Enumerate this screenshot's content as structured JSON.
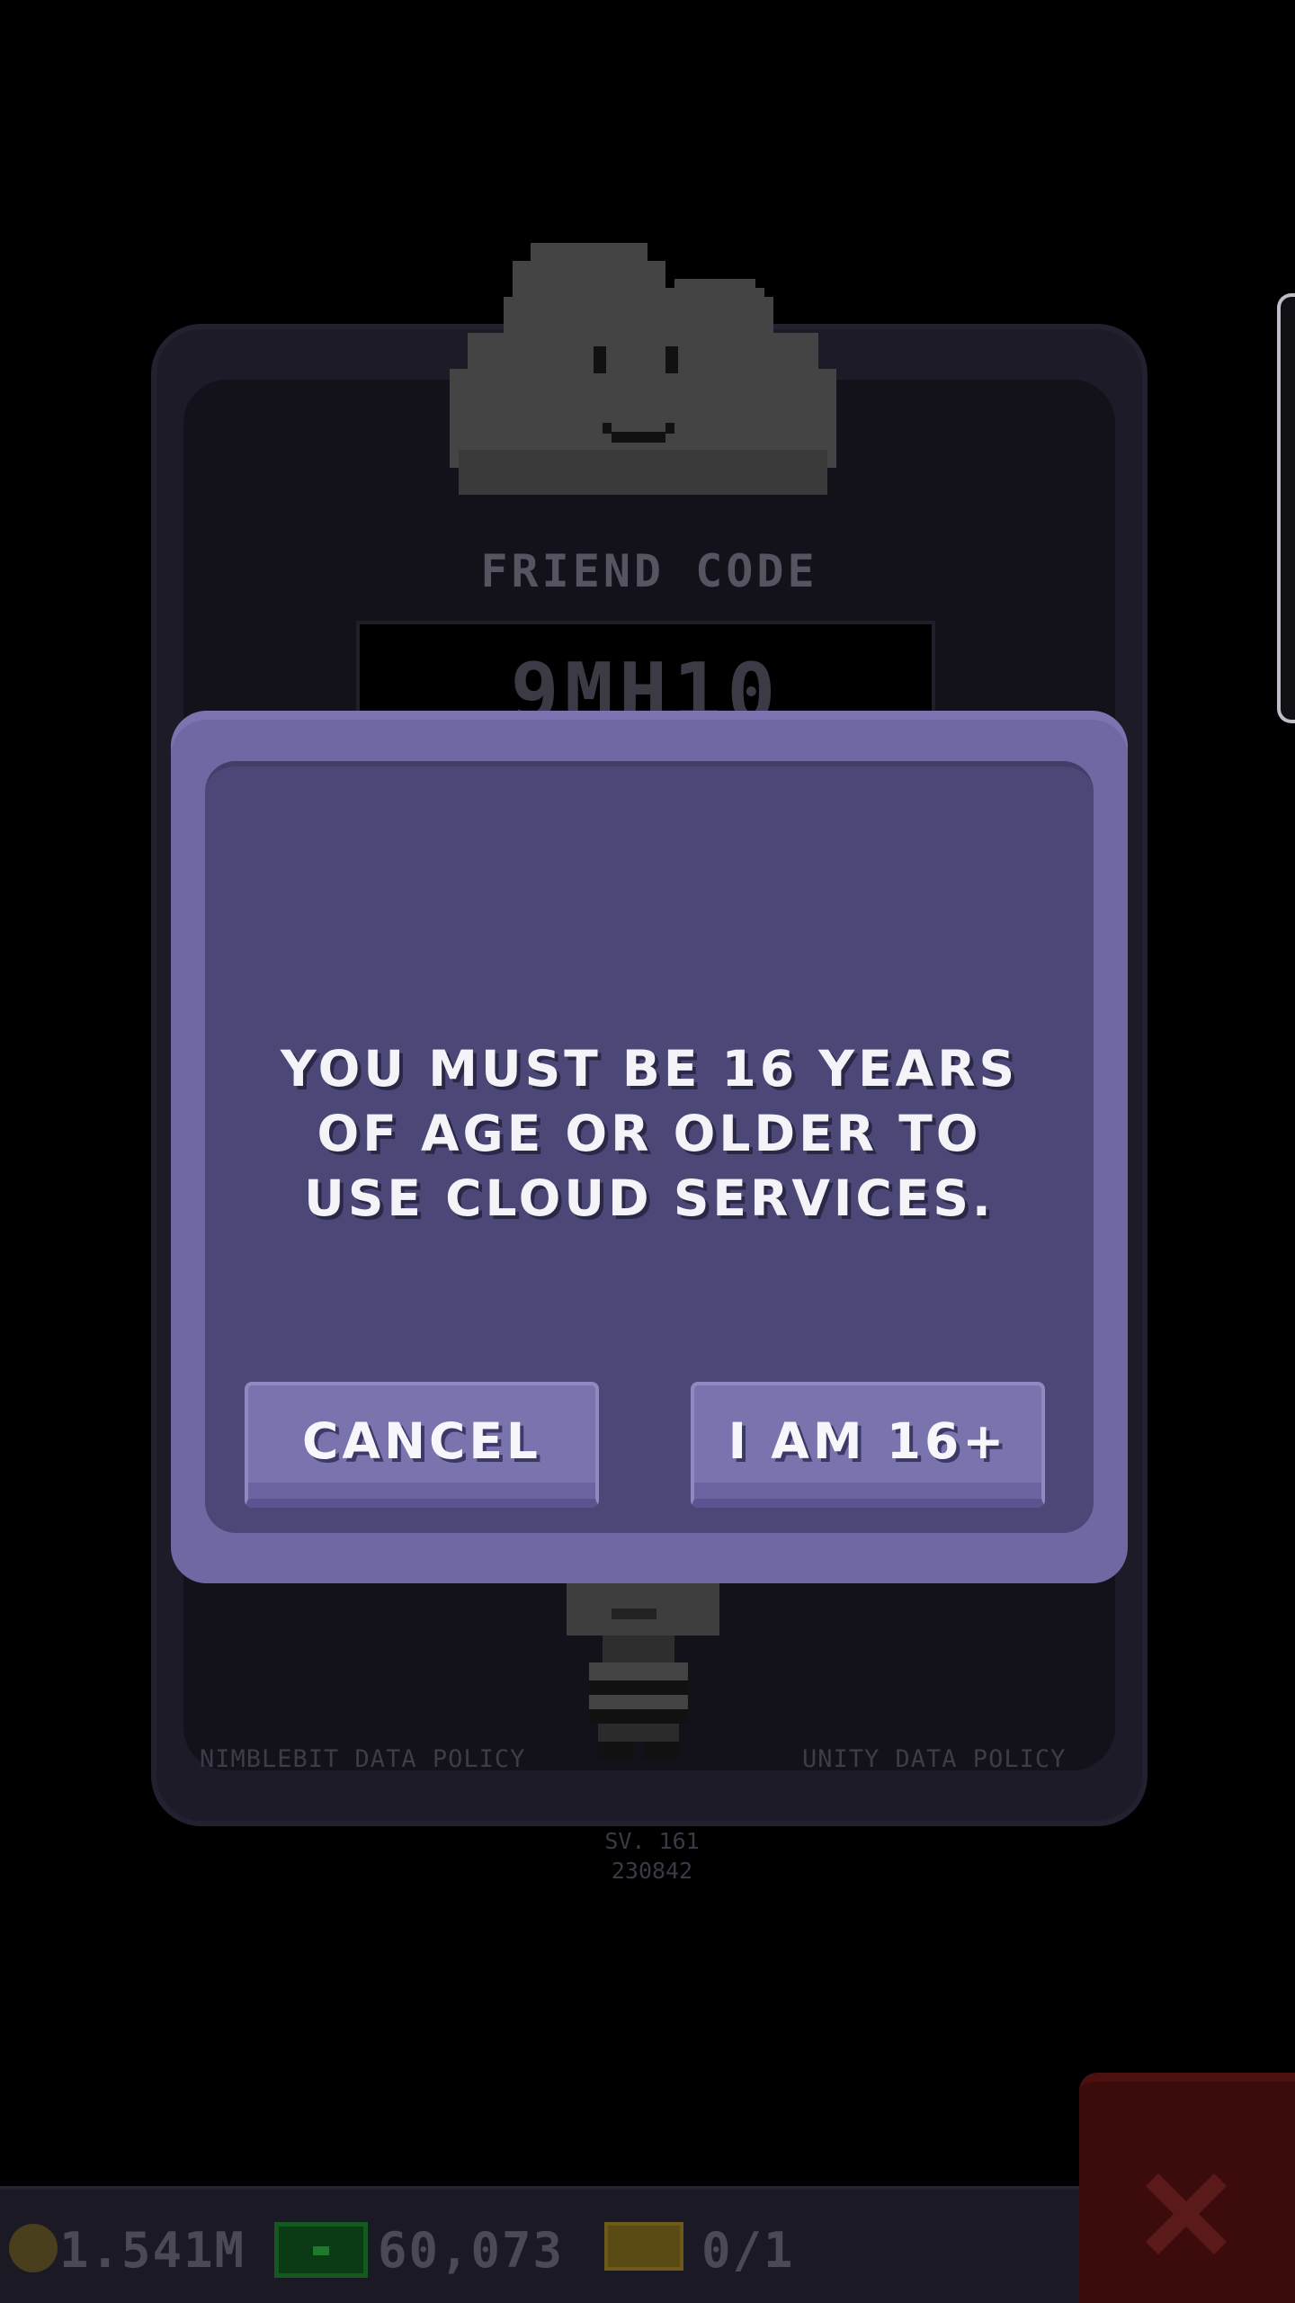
{
  "background_panel": {
    "friend_code_label": "FRIEND CODE",
    "friend_code_value": "9MH10",
    "nimblebit_policy_link": "NIMBLEBIT DATA POLICY",
    "unity_policy_link": "UNITY DATA POLICY",
    "version_line1": "SV. 161",
    "version_line2": "230842"
  },
  "dialog": {
    "message": "YOU MUST BE 16 YEARS OF AGE OR OLDER TO USE CLOUD SERVICES.",
    "cancel_label": "CANCEL",
    "confirm_label": "I AM 16+"
  },
  "status_bar": {
    "coins": "1.541M",
    "cash": "60,073",
    "tickets": "0/1"
  },
  "icons": {
    "mascot": "cloud-mascot-icon",
    "coin": "coin-icon",
    "cash": "cash-icon",
    "ticket": "ticket-icon",
    "close": "close-icon"
  },
  "colors": {
    "dialog_frame": "#6f68a3",
    "dialog_body": "#4b4776",
    "button": "#7a74ae",
    "close_button": "#3c0b0b"
  }
}
